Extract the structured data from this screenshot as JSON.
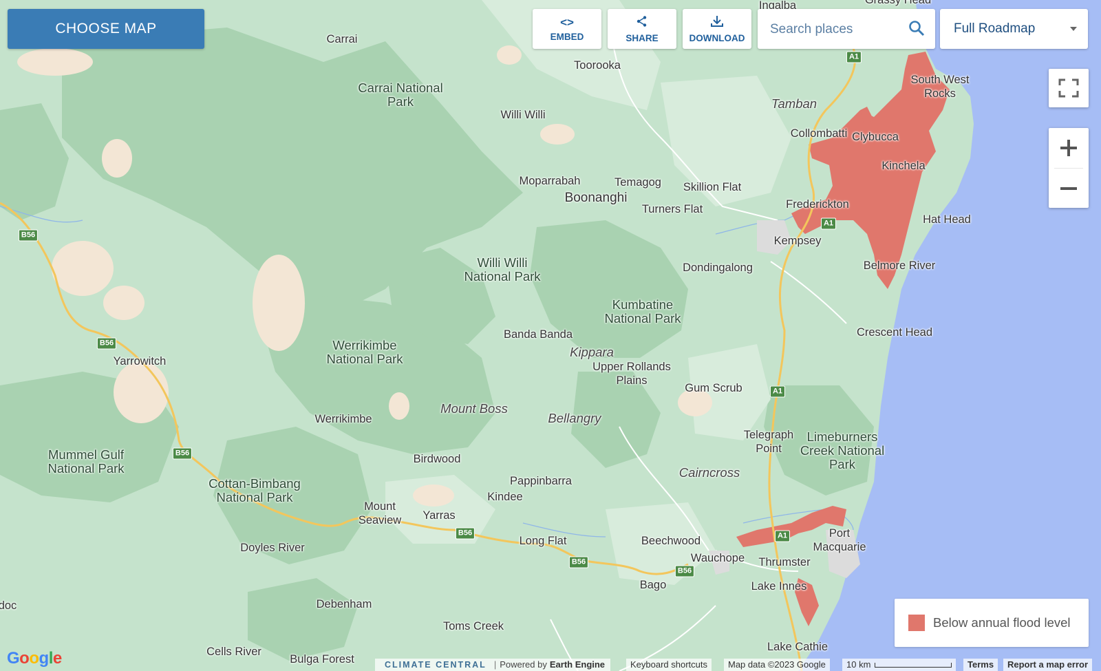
{
  "header": {
    "choose_map_label": "CHOOSE MAP",
    "embed_label": "EMBED",
    "share_label": "SHARE",
    "download_label": "DOWNLOAD",
    "search_placeholder": "Search places",
    "map_type_selected": "Full Roadmap"
  },
  "legend": {
    "label": "Below annual flood level",
    "color": "#e0776c"
  },
  "colors": {
    "flood": "#e0776c",
    "ocean": "#a6bdf5",
    "forest_dark": "#a9d2b1",
    "forest_light": "#c5e3cc",
    "bare": "#f3e6d5",
    "highway": "#f3c65c",
    "brand_blue": "#3a7cb5"
  },
  "places": {
    "ingalba": "Ingalba",
    "grassy_head": "Grassy Head",
    "carrai": "Carrai",
    "toorooka": "Toorooka",
    "carrai_np": "Carrai National Park",
    "willi_willi": "Willi Willi",
    "tamban": "Tamban",
    "south_west_rocks": "South West Rocks",
    "collombatti": "Collombatti",
    "clybucca": "Clybucca",
    "kinchela": "Kinchela",
    "moparrabah": "Moparrabah",
    "temagog": "Temagog",
    "boonanghi": "Boonanghi",
    "skillion_flat": "Skillion Flat",
    "turners_flat": "Turners Flat",
    "frederickton": "Frederickton",
    "hat_head": "Hat Head",
    "kempsey": "Kempsey",
    "willi_willi_np": "Willi Willi National Park",
    "dondingalong": "Dondingalong",
    "belmore_river": "Belmore River",
    "kumbatine_np": "Kumbatine National Park",
    "crescent_head": "Crescent Head",
    "banda_banda": "Banda Banda",
    "kippara": "Kippara",
    "werrikimbe_np": "Werrikimbe National Park",
    "yarrowitch": "Yarrowitch",
    "upper_rollands_plains": "Upper Rollands Plains",
    "gum_scrub": "Gum Scrub",
    "mount_boss": "Mount Boss",
    "bellangry": "Bellangry",
    "werrikimbe": "Werrikimbe",
    "telegraph_point": "Telegraph Point",
    "limeburners_np": "Limeburners Creek National Park",
    "mummel_gulf_np": "Mummel Gulf National Park",
    "birdwood": "Birdwood",
    "cairncross": "Cairncross",
    "cottan_bimbang_np": "Cottan-Bimbang National Park",
    "pappinbarra": "Pappinbarra",
    "kindee": "Kindee",
    "mount_seaview": "Mount Seaview",
    "yarras": "Yarras",
    "port_macquarie": "Port Macquarie",
    "long_flat": "Long Flat",
    "beechwood": "Beechwood",
    "doyles_river": "Doyles River",
    "wauchope": "Wauchope",
    "thrumster": "Thrumster",
    "bago": "Bago",
    "lake_innes": "Lake Innes",
    "doc": "doc",
    "debenham": "Debenham",
    "toms_creek": "Toms Creek",
    "lake_cathie": "Lake Cathie",
    "cells_river": "Cells River",
    "bulga_forest": "Bulga Forest"
  },
  "roads": {
    "b56": "B56",
    "a1": "A1"
  },
  "footer": {
    "google": "Google",
    "climate_central": "CLIMATE CENTRAL",
    "separator": "|",
    "powered_by": "Powered by",
    "earth_engine": "Earth Engine",
    "keyboard_shortcuts": "Keyboard shortcuts",
    "map_data": "Map data ©2023 Google",
    "scale_label": "10 km",
    "terms": "Terms",
    "report_error": "Report a map error"
  }
}
